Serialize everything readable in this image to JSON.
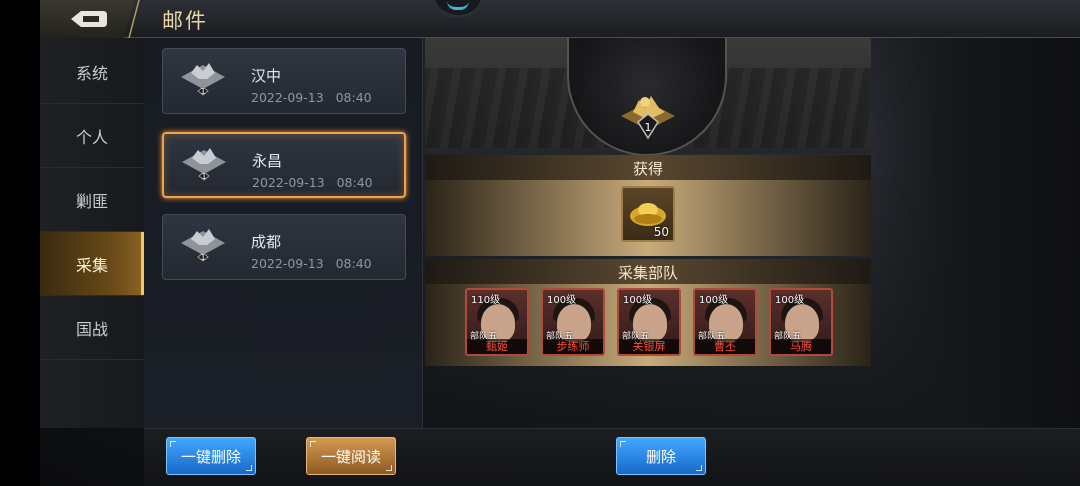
{
  "header": {
    "title": "邮件",
    "back_icon": "back-arrow-icon"
  },
  "sidebar": {
    "items": [
      {
        "label": "系统"
      },
      {
        "label": "个人"
      },
      {
        "label": "剿匪"
      },
      {
        "label": "采集",
        "active": true
      },
      {
        "label": "国战"
      }
    ]
  },
  "mail_list": {
    "items": [
      {
        "name": "汉中",
        "date": "2022-09-13",
        "time": "08:40",
        "level": "1"
      },
      {
        "name": "永昌",
        "date": "2022-09-13",
        "time": "08:40",
        "level": "1",
        "selected": true
      },
      {
        "name": "成都",
        "date": "2022-09-13",
        "time": "08:40",
        "level": "1"
      }
    ]
  },
  "detail": {
    "resource_level": "1",
    "reward_header": "获得",
    "reward": {
      "icon": "gold-ingot-icon",
      "count": "50"
    },
    "troops_header": "采集部队",
    "heroes": [
      {
        "level": "110级",
        "squad": "部队五",
        "name": "甄姬"
      },
      {
        "level": "100级",
        "squad": "部队五",
        "name": "步练师"
      },
      {
        "level": "100级",
        "squad": "部队五",
        "name": "关银屏"
      },
      {
        "level": "100级",
        "squad": "部队五",
        "name": "曹丕"
      },
      {
        "level": "100级",
        "squad": "部队五",
        "name": "马腾"
      }
    ]
  },
  "buttons": {
    "delete_all": "一键删除",
    "read_all": "一键阅读",
    "delete": "删除"
  },
  "colors": {
    "accent_gold": "#f0a34a",
    "button_blue": "#1769c8",
    "hero_name_red": "#ff4e3a"
  }
}
